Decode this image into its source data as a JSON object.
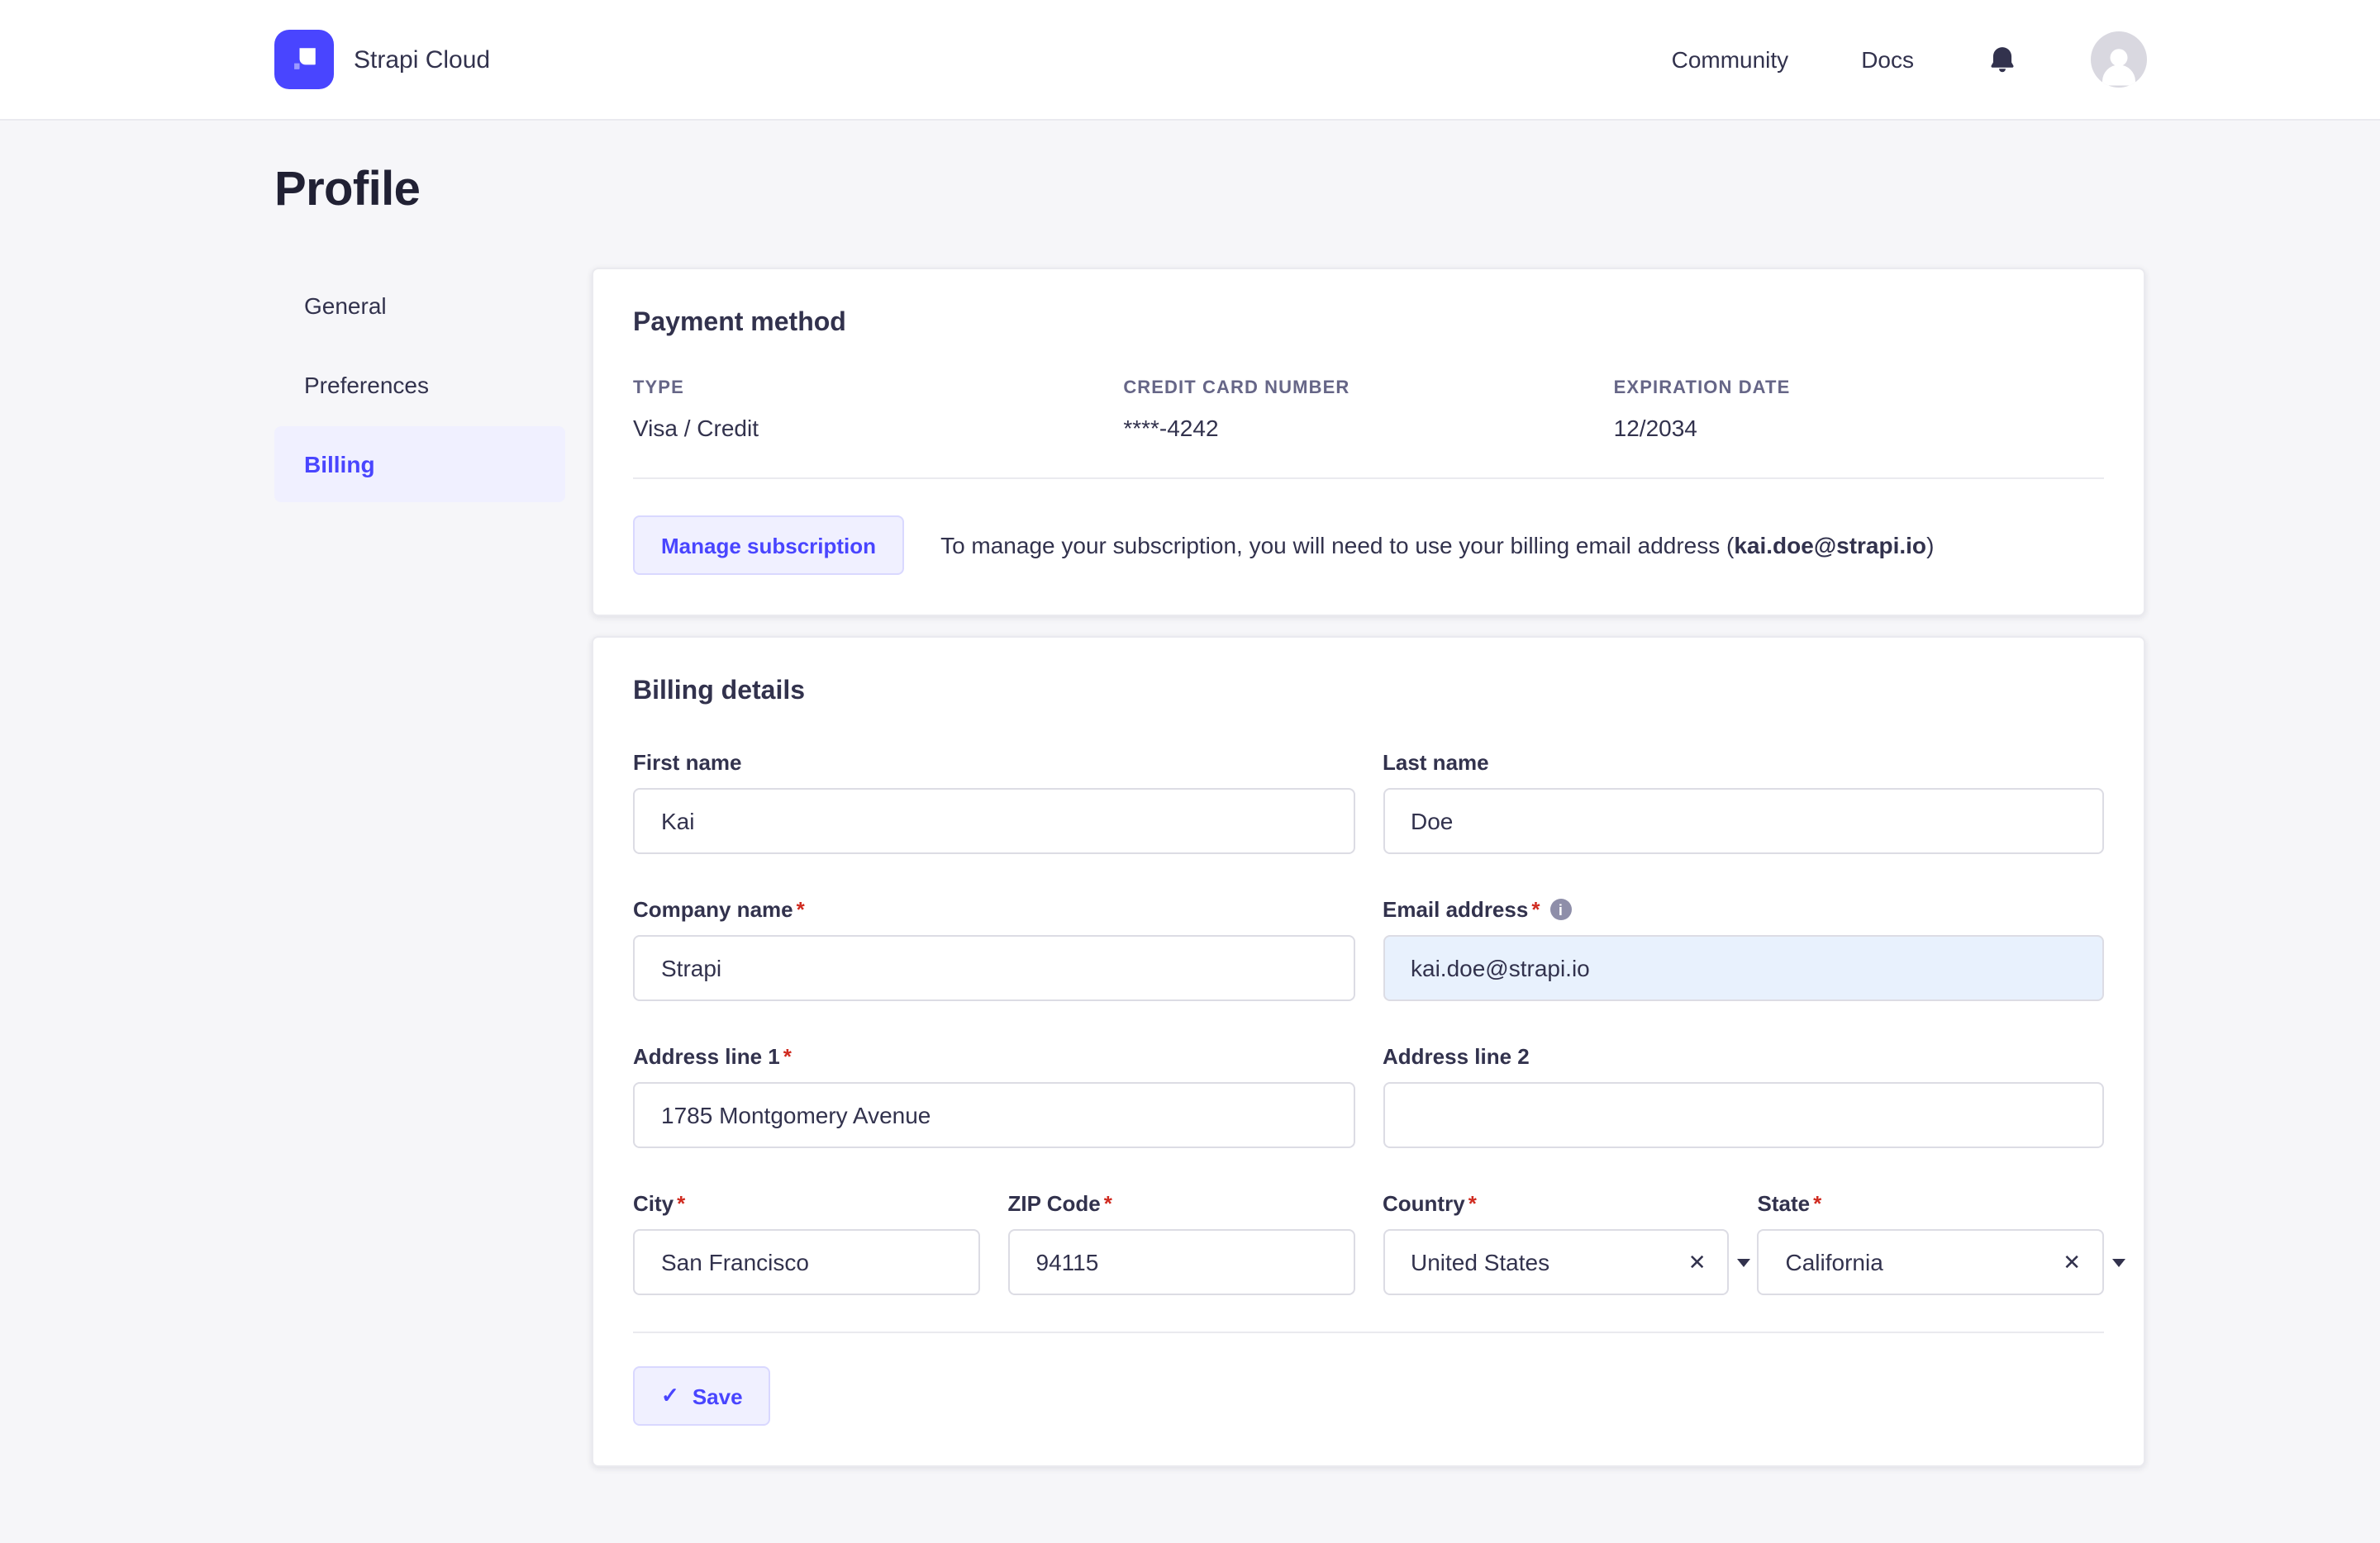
{
  "colors": {
    "accent": "#4945ff",
    "accent_bg": "#f0f0ff",
    "accent_border": "#d9d8ff",
    "danger": "#d02b20",
    "page_bg": "#f6f6f9",
    "text": "#32324d",
    "muted": "#666687",
    "autofill_bg": "#e8f1fd"
  },
  "header": {
    "brand": "Strapi Cloud",
    "community": "Community",
    "docs": "Docs"
  },
  "page": {
    "title": "Profile"
  },
  "sidebar": {
    "general": "General",
    "preferences": "Preferences",
    "billing": "Billing"
  },
  "payment": {
    "title": "Payment method",
    "fields": [
      {
        "label": "TYPE",
        "value": "Visa / Credit"
      },
      {
        "label": "CREDIT CARD NUMBER",
        "value": "****-4242"
      },
      {
        "label": "EXPIRATION DATE",
        "value": "12/2034"
      }
    ],
    "manage_button": "Manage subscription",
    "note_prefix": "To manage your subscription, you will need to use your billing email address (",
    "note_email": "kai.doe@strapi.io",
    "note_suffix": ")"
  },
  "billing": {
    "title": "Billing details",
    "first_name": {
      "label": "First name",
      "req": "",
      "value": "Kai"
    },
    "last_name": {
      "label": "Last name",
      "req": "",
      "value": "Doe"
    },
    "company": {
      "label": "Company name",
      "req": "*",
      "value": "Strapi"
    },
    "email": {
      "label": "Email address",
      "req": "*",
      "value": "kai.doe@strapi.io"
    },
    "address1": {
      "label": "Address line 1",
      "req": "*",
      "value": "1785 Montgomery Avenue"
    },
    "address2": {
      "label": "Address line 2",
      "req": "",
      "value": ""
    },
    "city": {
      "label": "City",
      "req": "*",
      "value": "San Francisco"
    },
    "zip": {
      "label": "ZIP Code",
      "req": "*",
      "value": "94115"
    },
    "country": {
      "label": "Country",
      "req": "*",
      "value": "United States"
    },
    "state": {
      "label": "State",
      "req": "*",
      "value": "California"
    },
    "save_label": "Save"
  },
  "icons": {
    "clear": "✕",
    "check": "✓",
    "info": "i"
  }
}
